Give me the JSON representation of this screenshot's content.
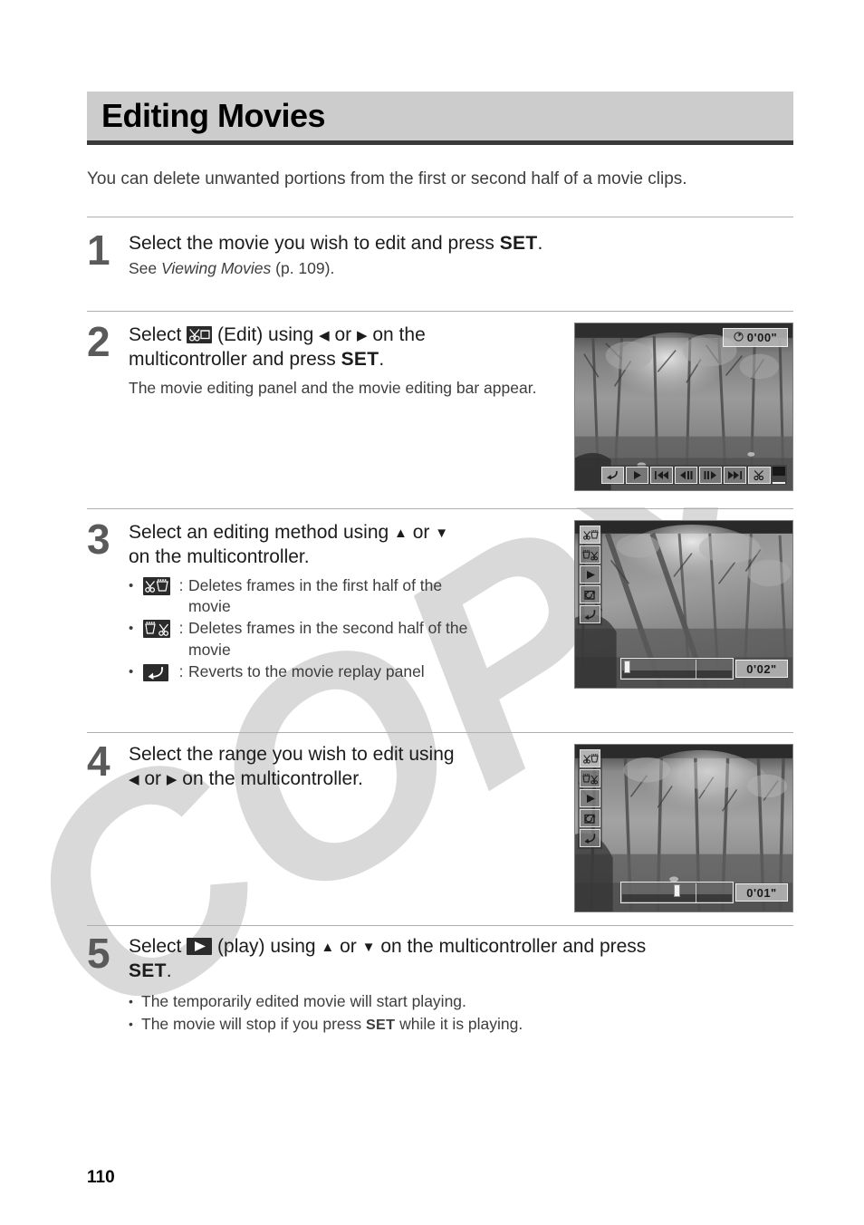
{
  "document": {
    "title": "Editing Movies",
    "intro": "You can delete unwanted portions from the first or second half of a movie clips.",
    "page_number": "110",
    "watermark_text": "COPY",
    "colors": {
      "banner_background": "#cccccc",
      "banner_rule": "#3a3a3a",
      "body_text": "#3d3d3d",
      "step_number": "#5a5a5a",
      "separator": "#aeaeae",
      "icon_background": "#2b2b2b",
      "watermark": "#d8d8d8"
    }
  },
  "steps": [
    {
      "number": "1",
      "heading_before": "Select the movie you wish to edit and press ",
      "heading_set": "SET",
      "heading_after": ".",
      "sub_before": "See ",
      "sub_italic": "Viewing Movies",
      "sub_after": " (p. 109)."
    },
    {
      "number": "2",
      "line1_before": "Select ",
      "line1_icon": "scissors-edit-icon",
      "line1_mid": " (Edit) using ",
      "line1_left_arrow": "◀",
      "line1_or": " or ",
      "line1_right_arrow": "▶",
      "line1_after": " on the",
      "line2_before": "multicontroller and press ",
      "line2_set": "SET",
      "line2_after": ".",
      "sub": "The movie editing panel and the movie editing bar appear."
    },
    {
      "number": "3",
      "line1_before": "Select an editing method using ",
      "line1_up_arrow": "▲",
      "line1_or": " or ",
      "line1_down_arrow": "▼",
      "line2": "on the multicontroller.",
      "bullets": [
        {
          "dot": "•",
          "icon": "cut-first-half-icon",
          "colon": ":",
          "text": "Deletes frames in the first half of the movie"
        },
        {
          "dot": "•",
          "icon": "cut-second-half-icon",
          "colon": ":",
          "text": "Deletes frames in the second half of the movie"
        },
        {
          "dot": "•",
          "icon": "revert-icon",
          "colon": ":",
          "text": "Reverts to the movie replay panel"
        }
      ]
    },
    {
      "number": "4",
      "line1": "Select the range you wish to edit using",
      "line2_left_arrow": "◀",
      "line2_or": " or ",
      "line2_right_arrow": "▶",
      "line2_after": " on the multicontroller."
    },
    {
      "number": "5",
      "line1_before": "Select ",
      "line1_icon": "play-icon",
      "line1_mid": " (play) using ",
      "line1_up_arrow": "▲",
      "line1_or": " or ",
      "line1_down_arrow": "▼",
      "line1_after": " on the multicontroller and press",
      "line2_set": "SET",
      "line2_after": ".",
      "bullets": [
        {
          "dot": "•",
          "text": "The temporarily edited movie will start playing."
        },
        {
          "dot": "•",
          "before": "The movie will stop if you press ",
          "set": "SET",
          "after": " while it is playing."
        }
      ]
    }
  ],
  "screenshots": [
    {
      "id": "movie-replay-panel-screen",
      "step": "2",
      "timer": "0'00\"",
      "timer_icon": "clock-icon",
      "controls": [
        {
          "name": "exit-button",
          "glyph": "return",
          "selected": true
        },
        {
          "name": "play-button",
          "glyph": "play",
          "selected": false
        },
        {
          "name": "rewind-button",
          "glyph": "rewind",
          "selected": false
        },
        {
          "name": "previous-frame-button",
          "glyph": "prev-frame",
          "selected": false
        },
        {
          "name": "next-frame-button",
          "glyph": "next-frame",
          "selected": false
        },
        {
          "name": "fast-forward-button",
          "glyph": "fast-forward",
          "selected": false
        },
        {
          "name": "edit-scissors-button",
          "glyph": "scissors",
          "selected": true
        },
        {
          "name": "print-button",
          "glyph": "print",
          "selected": false
        }
      ]
    },
    {
      "id": "movie-editing-panel-screen",
      "step": "3",
      "timer": "0'02\"",
      "panel": [
        {
          "name": "cut-first-half-button",
          "glyph": "cut-first",
          "selected": true
        },
        {
          "name": "cut-second-half-button",
          "glyph": "cut-second",
          "selected": false
        },
        {
          "name": "play-button",
          "glyph": "play",
          "selected": false
        },
        {
          "name": "save-new-file-button",
          "glyph": "save-new",
          "selected": false
        },
        {
          "name": "revert-button",
          "glyph": "revert",
          "selected": false
        }
      ],
      "slider_position_pct": 3
    },
    {
      "id": "movie-editing-range-screen",
      "step": "4",
      "timer": "0'01\"",
      "panel": [
        {
          "name": "cut-first-half-button",
          "glyph": "cut-first",
          "selected": true
        },
        {
          "name": "cut-second-half-button",
          "glyph": "cut-second",
          "selected": false
        },
        {
          "name": "play-button",
          "glyph": "play",
          "selected": false
        },
        {
          "name": "save-new-file-button",
          "glyph": "save-new",
          "selected": false
        },
        {
          "name": "revert-button",
          "glyph": "revert",
          "selected": false
        }
      ],
      "slider_position_pct": 48
    }
  ]
}
